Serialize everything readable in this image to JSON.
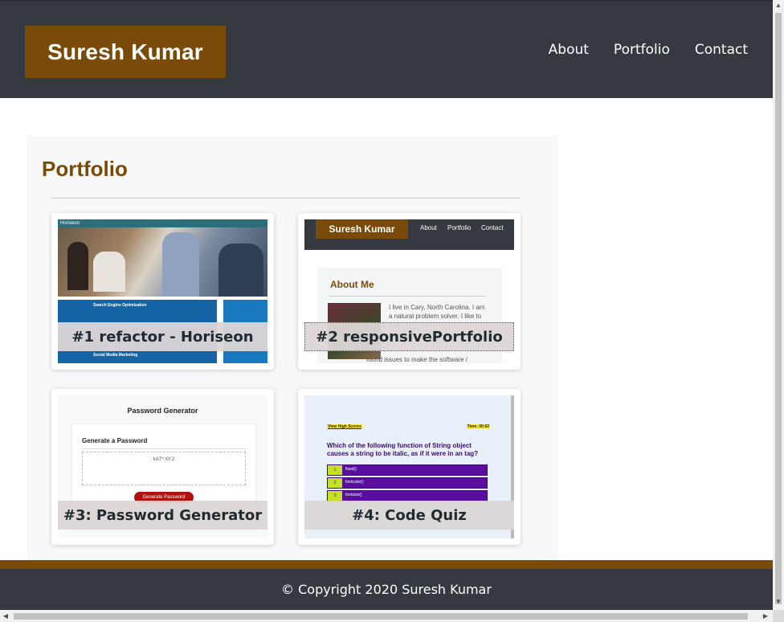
{
  "header": {
    "brand": "Suresh Kumar",
    "nav": [
      "About",
      "Portfolio",
      "Contact"
    ]
  },
  "portfolio": {
    "title": "Portfolio",
    "projects": [
      {
        "caption": "#1 refactor - Horiseon",
        "thumb": {
          "site_name": "Horiseon",
          "label_a": "Search Engine Optimization",
          "label_b": "Social Media Marketing"
        }
      },
      {
        "caption": "#2 responsivePortfolio",
        "thumb": {
          "brand": "Suresh Kumar",
          "nav": [
            "About",
            "Portfolio",
            "Contact"
          ],
          "heading": "About Me",
          "text": "I live in Cary, North Carolina. I am a natural problem solver. I like to add",
          "text_bottom": "found issues to make the software /"
        }
      },
      {
        "caption": "#3: Password Generator",
        "thumb": {
          "title": "Password Generator",
          "subtitle": "Generate a Password",
          "password": "kA7^.\\0l`2",
          "button": "Generate Password"
        }
      },
      {
        "caption": "#4: Code Quiz",
        "thumb": {
          "high_scores": "View High Scores",
          "timer": "Time: 00:62",
          "question": "Which of the following function of String object causes a string to be italic, as if it were in an tag?",
          "options": [
            {
              "num": "1",
              "text": "fixed()"
            },
            {
              "num": "2",
              "text": "fontcolor()"
            },
            {
              "num": "3",
              "text": "fontsize()"
            }
          ]
        }
      }
    ]
  },
  "footer": {
    "copyright": "© Copyright 2020 Suresh Kumar"
  },
  "colors": {
    "brand": "#7a4a08",
    "header_bg": "#343a40",
    "section_bg": "#f7f8f9"
  }
}
